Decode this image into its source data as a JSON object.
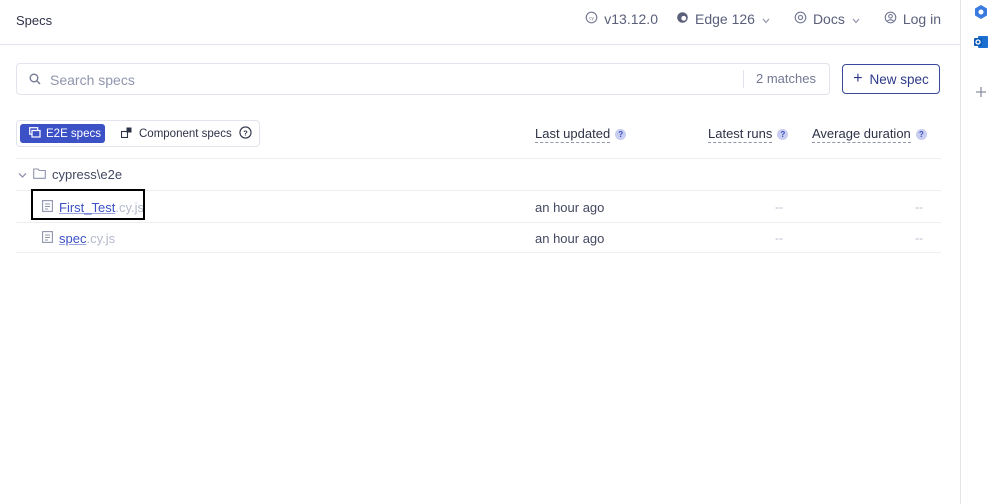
{
  "header": {
    "title": "Specs",
    "version": "v13.12.0",
    "browser": "Edge 126",
    "docs": "Docs",
    "login": "Log in"
  },
  "search": {
    "placeholder": "Search specs",
    "matches": "2 matches"
  },
  "new_spec_button": "New spec",
  "testing_type_toggle": {
    "e2e": "E2E specs",
    "component": "Component specs",
    "selected": "E2E specs"
  },
  "columns": {
    "last_updated": "Last updated",
    "latest_runs": "Latest runs",
    "average_duration": "Average duration"
  },
  "folder": {
    "name": "cypress\\e2e"
  },
  "specs": [
    {
      "base": "First_Test",
      "ext": ".cy.js",
      "updated": "an hour ago",
      "latest_runs": "--",
      "avg_duration": "--"
    },
    {
      "base": "spec",
      "ext": ".cy.js",
      "updated": "an hour ago",
      "latest_runs": "--",
      "avg_duration": "--"
    }
  ],
  "colors": {
    "accent": "#3c51c5",
    "text": "#434861",
    "border": "#e1e3ed"
  }
}
